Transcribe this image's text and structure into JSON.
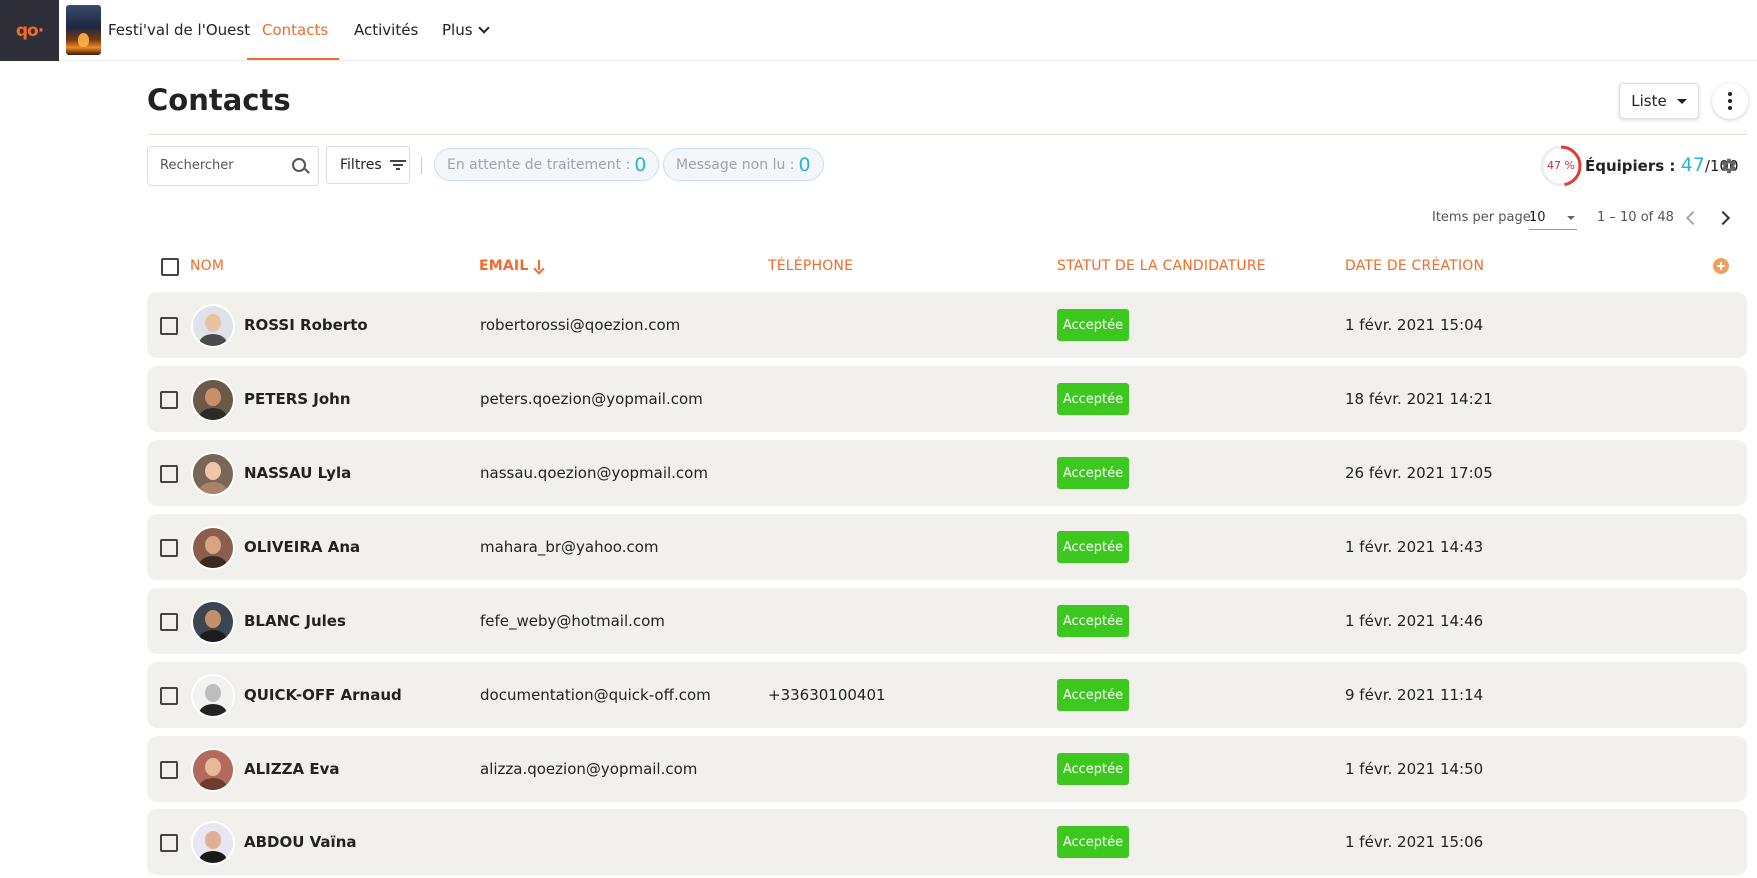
{
  "brand": {
    "logo_text": "qo·"
  },
  "event": {
    "name": "Festi'val de l'Ouest"
  },
  "nav": {
    "contacts": "Contacts",
    "activities": "Activités",
    "more": "Plus"
  },
  "page": {
    "title": "Contacts",
    "view_label": "Liste"
  },
  "toolbar": {
    "search_placeholder": "Rechercher",
    "filters_label": "Filtres",
    "pending_label": "En attente de traitement :",
    "pending_count": "0",
    "unread_label": "Message non lu :",
    "unread_count": "0"
  },
  "equipment": {
    "percent_label": "47 %",
    "percent": 47,
    "label": "Équipiers :",
    "count": "47",
    "total": "/100"
  },
  "paginator": {
    "label": "Items per page:",
    "page_size": "10",
    "range": "1 – 10 of 48"
  },
  "columns": {
    "name": "NOM",
    "email": "EMAIL",
    "phone": "TÉLÉPHONE",
    "status": "STATUT DE LA CANDIDATURE",
    "date": "DATE DE CRÉATION"
  },
  "rows": [
    {
      "name": "ROSSI Roberto",
      "email": "robertorossi@qoezion.com",
      "phone": "",
      "status": "Acceptée",
      "date": "1 févr. 2021 15:04"
    },
    {
      "name": "PETERS John",
      "email": "peters.qoezion@yopmail.com",
      "phone": "",
      "status": "Acceptée",
      "date": "18 févr. 2021 14:21"
    },
    {
      "name": "NASSAU Lyla",
      "email": "nassau.qoezion@yopmail.com",
      "phone": "",
      "status": "Acceptée",
      "date": "26 févr. 2021 17:05"
    },
    {
      "name": "OLIVEIRA Ana",
      "email": "mahara_br@yahoo.com",
      "phone": "",
      "status": "Acceptée",
      "date": "1 févr. 2021 14:43"
    },
    {
      "name": "BLANC Jules",
      "email": "fefe_weby@hotmail.com",
      "phone": "",
      "status": "Acceptée",
      "date": "1 févr. 2021 14:46"
    },
    {
      "name": "QUICK-OFF Arnaud",
      "email": "documentation@quick-off.com",
      "phone": "+33630100401",
      "status": "Acceptée",
      "date": "9 févr. 2021 11:14"
    },
    {
      "name": "ALIZZA Eva",
      "email": "alizza.qoezion@yopmail.com",
      "phone": "",
      "status": "Acceptée",
      "date": "1 févr. 2021 14:50"
    },
    {
      "name": "ABDOU Vaïna",
      "email": "",
      "phone": "",
      "status": "Acceptée",
      "date": "1 févr. 2021 15:06"
    }
  ],
  "colors": {
    "accent": "#f26b2a",
    "status_accepted": "#3cc81e",
    "count_blue": "#29b6d6",
    "row_bg": "#f2f0ec"
  }
}
